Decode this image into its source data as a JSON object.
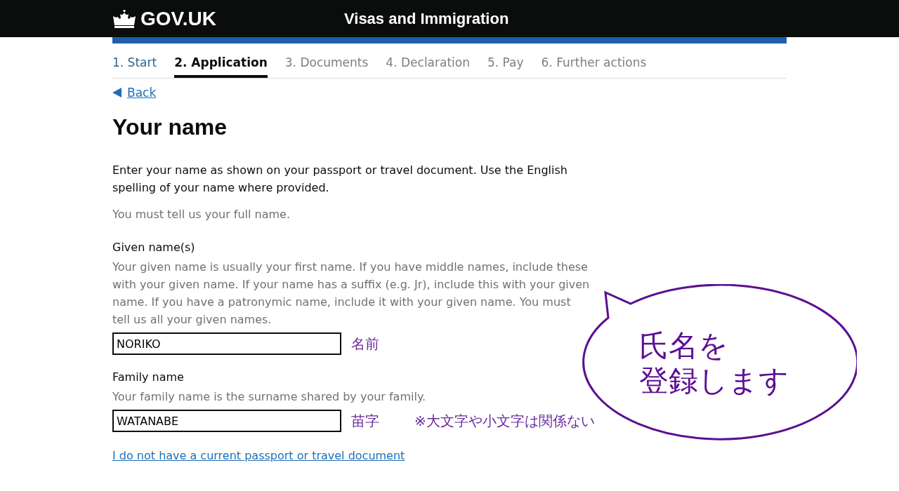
{
  "header": {
    "logo": "GOV.UK",
    "service": "Visas and Immigration"
  },
  "steps": [
    {
      "label": "1. Start",
      "selected": false,
      "completed": true
    },
    {
      "label": "2. Application",
      "selected": true,
      "completed": false
    },
    {
      "label": "3. Documents",
      "selected": false,
      "completed": false
    },
    {
      "label": "4. Declaration",
      "selected": false,
      "completed": false
    },
    {
      "label": "5. Pay",
      "selected": false,
      "completed": false
    },
    {
      "label": "6. Further actions",
      "selected": false,
      "completed": false
    }
  ],
  "back_link": "Back",
  "heading": "Your name",
  "intro": "Enter your name as shown on your passport or travel document. Use the English spelling of your name where provided.",
  "requirement": "You must tell us your full name.",
  "fields": [
    {
      "label": "Given name(s)",
      "hint": "Your given name is usually your first name. If you have middle names, include these with your given name. If your name has a suffix (e.g. Jr), include this with your given name. If you have a patronymic name, include it with your given name. You must tell us all your given names.",
      "value": "NORIKO",
      "annotation": "名前"
    },
    {
      "label": "Family name",
      "hint": "Your family name is the surname shared by your family.",
      "value": "WATANABE",
      "annotation": "苗字",
      "note": "※大文字や小文字は関係ない"
    }
  ],
  "no_passport_link": "I do not have a current passport or travel document",
  "callout": {
    "lines": [
      "氏名を",
      "登録します"
    ]
  }
}
